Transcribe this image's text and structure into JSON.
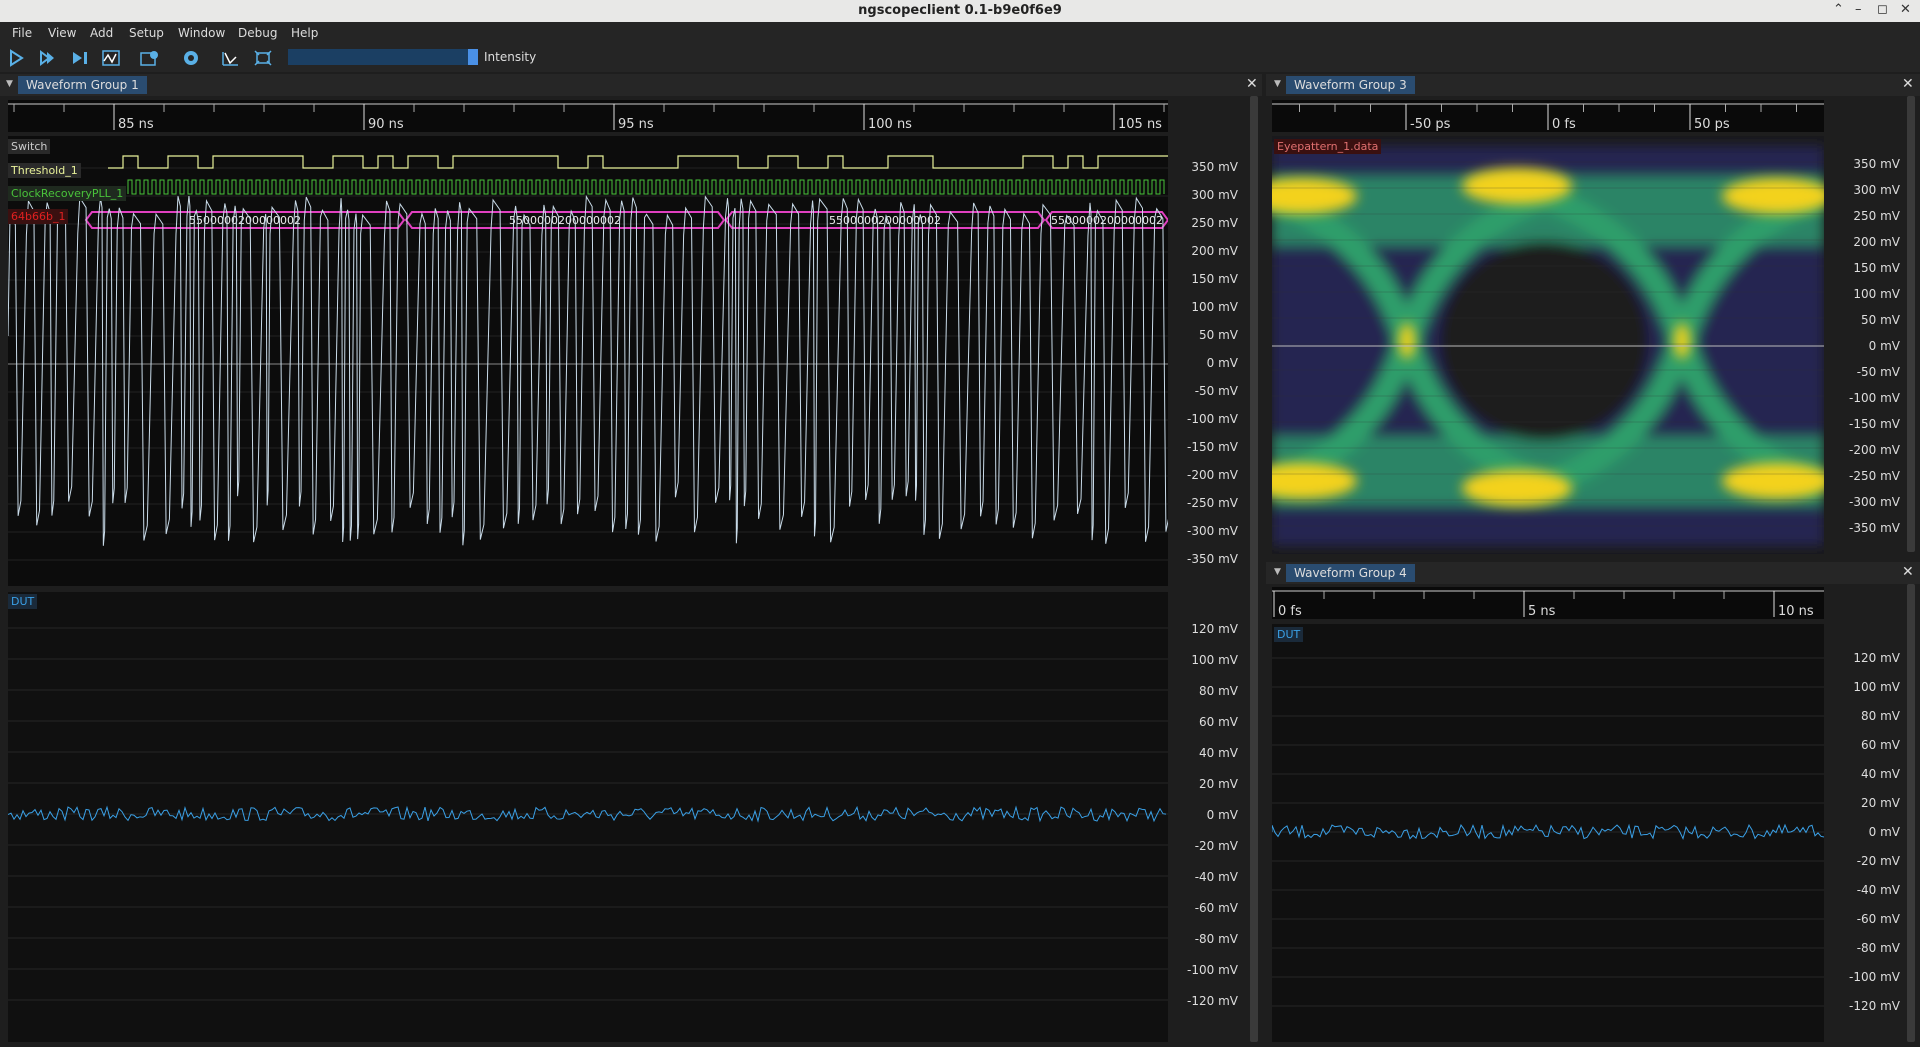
{
  "app": {
    "title": "ngscopeclient 0.1-b9e0f6e9"
  },
  "window_controls": {
    "up": "⌃",
    "minimize": "–",
    "maximize": "◻",
    "close": "✕"
  },
  "menu": [
    "File",
    "View",
    "Add",
    "Setup",
    "Window",
    "Debug",
    "Help"
  ],
  "toolbar": {
    "icons": [
      "run-icon",
      "single-trigger-icon",
      "force-trigger-icon",
      "history-icon",
      "stop-icon",
      "settings-icon",
      "measure-icon",
      "fit-icon"
    ],
    "intensity_label": "Intensity",
    "intensity_value": 1.0
  },
  "group1": {
    "tab": "Waveform Group 1",
    "close": "✕",
    "ruler": [
      "85 ns",
      "90 ns",
      "95 ns",
      "100 ns",
      "105 ns"
    ],
    "channels": {
      "switch": "Switch",
      "threshold": "Threshold_1",
      "clock": "ClockRecoveryPLL_1",
      "decode": "64b66b_1",
      "dut": "DUT"
    },
    "decode_values": [
      "5500000200000002",
      "5500000200000002",
      "5500000200000002",
      "5500000200000002"
    ],
    "top_axis": [
      "350 mV",
      "300 mV",
      "250 mV",
      "200 mV",
      "150 mV",
      "100 mV",
      "50 mV",
      "0 mV",
      "-50 mV",
      "-100 mV",
      "-150 mV",
      "-200 mV",
      "-250 mV",
      "-300 mV",
      "-350 mV"
    ],
    "bottom_axis": [
      "120 mV",
      "100 mV",
      "80 mV",
      "60 mV",
      "40 mV",
      "20 mV",
      "0 mV",
      "-20 mV",
      "-40 mV",
      "-60 mV",
      "-80 mV",
      "-100 mV",
      "-120 mV"
    ]
  },
  "group3": {
    "tab": "Waveform Group 3",
    "close": "✕",
    "ruler": [
      "-50 ps",
      "0 fs",
      "50 ps"
    ],
    "channel": "Eyepattern_1.data",
    "axis": [
      "350 mV",
      "300 mV",
      "250 mV",
      "200 mV",
      "150 mV",
      "100 mV",
      "50 mV",
      "0 mV",
      "-50 mV",
      "-100 mV",
      "-150 mV",
      "-200 mV",
      "-250 mV",
      "-300 mV",
      "-350 mV"
    ]
  },
  "group4": {
    "tab": "Waveform Group 4",
    "close": "✕",
    "ruler": [
      "0 fs",
      "5 ns",
      "10 ns"
    ],
    "channel": "DUT",
    "axis": [
      "120 mV",
      "100 mV",
      "80 mV",
      "60 mV",
      "40 mV",
      "20 mV",
      "0 mV",
      "-20 mV",
      "-40 mV",
      "-60 mV",
      "-80 mV",
      "-100 mV",
      "-120 mV"
    ]
  },
  "colors": {
    "analog": "#c9dbe9",
    "dut": "#3aa0e6",
    "threshold": "#e9f29a",
    "clock": "#49c23a",
    "decode": "#e040c0",
    "decode_label": "#e02020",
    "eye_hot": "#f3d21a",
    "eye_mid": "#2e9e6a",
    "eye_low": "#2a2a6a"
  }
}
